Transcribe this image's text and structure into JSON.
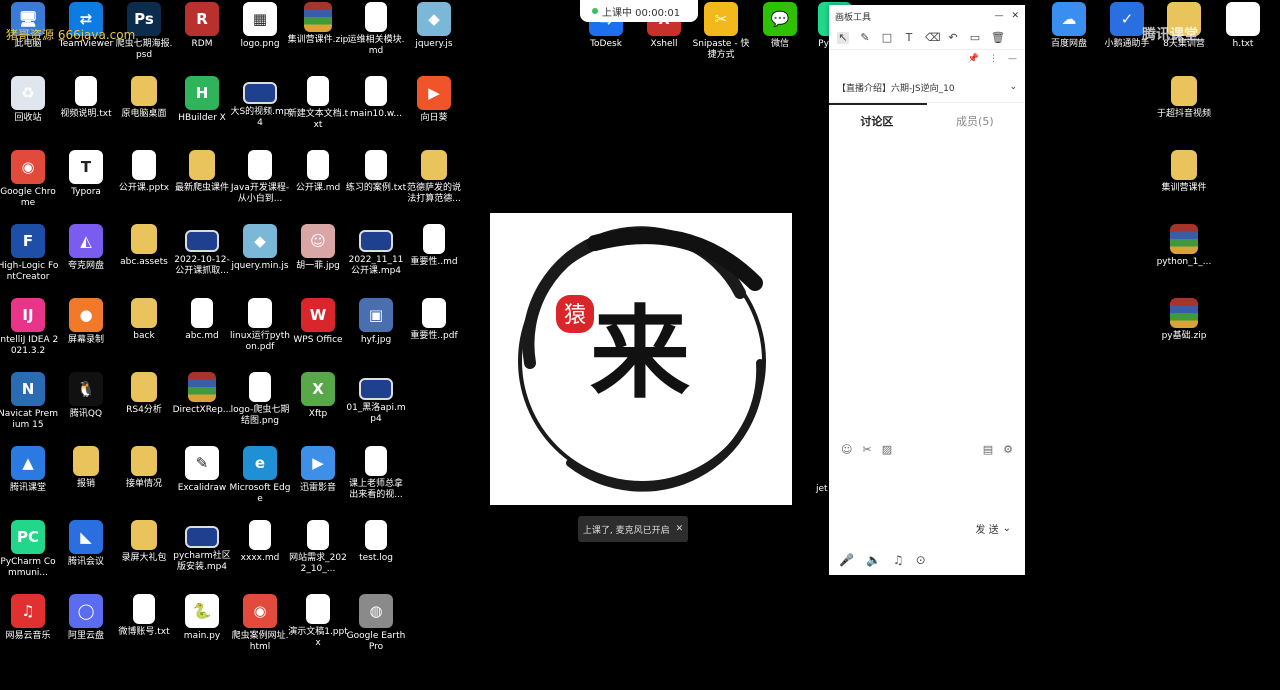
{
  "desktop_icons": [
    {
      "label": "此电脑",
      "icon": "computer-icon",
      "kind": "app",
      "color": "#3a7bd5",
      "glyph": "🖥"
    },
    {
      "label": "TeamViewer",
      "icon": "teamviewer-icon",
      "kind": "app",
      "color": "#0e7be0",
      "glyph": "⇄"
    },
    {
      "label": "爬虫七期海报.psd",
      "icon": "photoshop-icon",
      "kind": "app",
      "color": "#0b2c4c",
      "glyph": "Ps"
    },
    {
      "label": "RDM",
      "icon": "rdm-icon",
      "kind": "app",
      "color": "#b8312f",
      "glyph": "R"
    },
    {
      "label": "logo.png",
      "icon": "image-file-icon",
      "kind": "app",
      "color": "#ffffff",
      "glyph": "▦"
    },
    {
      "label": "集训营课件.zip",
      "icon": "zip-archive-icon",
      "kind": "zip"
    },
    {
      "label": "运维相关模块.md",
      "icon": "markdown-file-icon",
      "kind": "doc"
    },
    {
      "label": "jquery.js",
      "icon": "js-file-icon",
      "kind": "app",
      "color": "#7bb8d8",
      "glyph": "◆"
    },
    {
      "label": "回收站",
      "icon": "recycle-bin-icon",
      "kind": "app",
      "color": "#dfe6ee",
      "glyph": "♻"
    },
    {
      "label": "视频说明.txt",
      "icon": "text-file-icon",
      "kind": "doc"
    },
    {
      "label": "原电脑桌面",
      "icon": "folder-icon",
      "kind": "folder"
    },
    {
      "label": "HBuilder X",
      "icon": "hbuilder-icon",
      "kind": "app",
      "color": "#2eb45a",
      "glyph": "H"
    },
    {
      "label": "大S的视频.mp4",
      "icon": "video-file-icon",
      "kind": "video"
    },
    {
      "label": "新建文本文档.txt",
      "icon": "text-file-icon",
      "kind": "doc"
    },
    {
      "label": "main10.w...",
      "icon": "text-file-icon",
      "kind": "doc"
    },
    {
      "label": "向日葵",
      "icon": "sunflower-icon",
      "kind": "app",
      "color": "#f0552a",
      "glyph": "▶"
    },
    {
      "label": "Google Chrome",
      "icon": "chrome-icon",
      "kind": "app",
      "color": "#e24a3b",
      "glyph": "◉"
    },
    {
      "label": "Typora",
      "icon": "typora-icon",
      "kind": "app",
      "color": "#ffffff",
      "glyph": "T"
    },
    {
      "label": "公开课.pptx",
      "icon": "pptx-file-icon",
      "kind": "ppt"
    },
    {
      "label": "最新爬虫课件",
      "icon": "folder-icon",
      "kind": "folder"
    },
    {
      "label": "Java开发课程-从小白到...",
      "icon": "pdf-file-icon",
      "kind": "pdf"
    },
    {
      "label": "公开课.md",
      "icon": "markdown-file-icon",
      "kind": "doc"
    },
    {
      "label": "练习的案例.txt",
      "icon": "text-file-icon",
      "kind": "doc"
    },
    {
      "label": "范德萨发的说法打算范德...",
      "icon": "folder-icon",
      "kind": "folder"
    },
    {
      "label": "High-Logic FontCreator",
      "icon": "fontcreator-icon",
      "kind": "app",
      "color": "#1d4ea8",
      "glyph": "F"
    },
    {
      "label": "夸克网盘",
      "icon": "quark-icon",
      "kind": "app",
      "color": "#7a5cf0",
      "glyph": "◭"
    },
    {
      "label": "abc.assets",
      "icon": "folder-icon",
      "kind": "folder"
    },
    {
      "label": "2022-10-12-公开课抓取...",
      "icon": "video-file-icon",
      "kind": "video"
    },
    {
      "label": "jquery.min.js",
      "icon": "js-file-icon",
      "kind": "app",
      "color": "#7bb8d8",
      "glyph": "◆"
    },
    {
      "label": "胡一菲.jpg",
      "icon": "photo-file-icon",
      "kind": "app",
      "color": "#d9a5a5",
      "glyph": "☺"
    },
    {
      "label": "2022_11_11公开课.mp4",
      "icon": "video-file-icon",
      "kind": "video"
    },
    {
      "label": "重要性..md",
      "icon": "markdown-file-icon",
      "kind": "doc"
    },
    {
      "label": "IntelliJ IDEA 2021.3.2",
      "icon": "intellij-icon",
      "kind": "app",
      "color": "#e8358a",
      "glyph": "IJ"
    },
    {
      "label": "屏幕录制",
      "icon": "screen-record-icon",
      "kind": "app",
      "color": "#f07a2a",
      "glyph": "●"
    },
    {
      "label": "back",
      "icon": "folder-icon",
      "kind": "folder"
    },
    {
      "label": "abc.md",
      "icon": "markdown-file-icon",
      "kind": "doc"
    },
    {
      "label": "linux运行python.pdf",
      "icon": "pdf-file-icon",
      "kind": "pdf"
    },
    {
      "label": "WPS Office",
      "icon": "wps-icon",
      "kind": "app",
      "color": "#d9262c",
      "glyph": "W"
    },
    {
      "label": "hyf.jpg",
      "icon": "photo-file-icon",
      "kind": "app",
      "color": "#4a6fb0",
      "glyph": "▣"
    },
    {
      "label": "重要性..pdf",
      "icon": "pdf-file-icon",
      "kind": "pdf"
    },
    {
      "label": "Navicat Premium 15",
      "icon": "navicat-icon",
      "kind": "app",
      "color": "#2b6bb4",
      "glyph": "N"
    },
    {
      "label": "腾讯QQ",
      "icon": "qq-icon",
      "kind": "app",
      "color": "#111111",
      "glyph": "🐧"
    },
    {
      "label": "RS4分析",
      "icon": "folder-icon",
      "kind": "folder"
    },
    {
      "label": "DirectXRep...",
      "icon": "zip-archive-icon",
      "kind": "zip"
    },
    {
      "label": "logo-爬虫七期结图.png",
      "icon": "image-file-icon",
      "kind": "doc"
    },
    {
      "label": "Xftp",
      "icon": "xftp-icon",
      "kind": "app",
      "color": "#58a84a",
      "glyph": "X"
    },
    {
      "label": "01_黑洛api.mp4",
      "icon": "video-file-icon",
      "kind": "video"
    },
    {
      "label": "",
      "icon": "",
      "kind": "none"
    },
    {
      "label": "腾讯课堂",
      "icon": "tencent-classroom-icon",
      "kind": "app",
      "color": "#2a7ae2",
      "glyph": "▲"
    },
    {
      "label": "报销",
      "icon": "folder-icon",
      "kind": "folder"
    },
    {
      "label": "接单情况",
      "icon": "folder-icon",
      "kind": "folder"
    },
    {
      "label": "Excalidraw",
      "icon": "excalidraw-icon",
      "kind": "app",
      "color": "#ffffff",
      "glyph": "✎"
    },
    {
      "label": "Microsoft Edge",
      "icon": "edge-icon",
      "kind": "app",
      "color": "#1f8fd6",
      "glyph": "e"
    },
    {
      "label": "迅雷影音",
      "icon": "xunlei-icon",
      "kind": "app",
      "color": "#3d8fe8",
      "glyph": "▶"
    },
    {
      "label": "课上老师总拿出来看的视...",
      "icon": "text-file-icon",
      "kind": "doc"
    },
    {
      "label": "",
      "icon": "",
      "kind": "none"
    },
    {
      "label": "PyCharm Communi...",
      "icon": "pycharm-icon",
      "kind": "app",
      "color": "#21d789",
      "glyph": "PC"
    },
    {
      "label": "腾讯会议",
      "icon": "tencent-meeting-icon",
      "kind": "app",
      "color": "#2a6fe0",
      "glyph": "◣"
    },
    {
      "label": "录屏大礼包",
      "icon": "folder-icon",
      "kind": "folder"
    },
    {
      "label": "pycharm社区版安装.mp4",
      "icon": "video-file-icon",
      "kind": "video"
    },
    {
      "label": "xxxx.md",
      "icon": "markdown-file-icon",
      "kind": "doc"
    },
    {
      "label": "网站需求_2022_10_...",
      "icon": "word-file-icon",
      "kind": "doc"
    },
    {
      "label": "test.log",
      "icon": "log-file-icon",
      "kind": "doc"
    },
    {
      "label": "",
      "icon": "",
      "kind": "none"
    },
    {
      "label": "网易云音乐",
      "icon": "netease-music-icon",
      "kind": "app",
      "color": "#e03030",
      "glyph": "♫"
    },
    {
      "label": "阿里云盘",
      "icon": "aliyun-drive-icon",
      "kind": "app",
      "color": "#5a6cf0",
      "glyph": "◯"
    },
    {
      "label": "微博账号.txt",
      "icon": "text-file-icon",
      "kind": "doc"
    },
    {
      "label": "main.py",
      "icon": "python-file-icon",
      "kind": "app",
      "color": "#ffffff",
      "glyph": "🐍"
    },
    {
      "label": "爬虫案例网址.html",
      "icon": "chrome-html-icon",
      "kind": "app",
      "color": "#e24a3b",
      "glyph": "◉"
    },
    {
      "label": "演示文稿1.pptx",
      "icon": "pptx-file-icon",
      "kind": "ppt"
    },
    {
      "label": "Google Earth Pro",
      "icon": "google-earth-icon",
      "kind": "app",
      "color": "#8a8a8a",
      "glyph": "◍"
    },
    {
      "label": "",
      "icon": "",
      "kind": "none"
    }
  ],
  "top_icons": [
    {
      "label": "ToDesk",
      "icon": "todesk-icon",
      "color": "#1d6ff0",
      "glyph": "⇆"
    },
    {
      "label": "Xshell",
      "icon": "xshell-icon",
      "color": "#c8302b",
      "glyph": "X"
    },
    {
      "label": "Snipaste - 快捷方式",
      "icon": "snipaste-icon",
      "color": "#f2b81c",
      "glyph": "✂"
    },
    {
      "label": "微信",
      "icon": "wechat-icon",
      "color": "#2dc100",
      "glyph": "💬"
    },
    {
      "label": "Py 20...",
      "icon": "pycharm-icon",
      "color": "#21d789",
      "glyph": "P"
    },
    {
      "label": "百度网盘",
      "icon": "baidu-netdisk-icon",
      "color": "#3a8ef0",
      "glyph": "☁"
    },
    {
      "label": "小鹅通助手",
      "icon": "xiaoe-icon",
      "color": "#2a6fe0",
      "glyph": "✓"
    },
    {
      "label": "8天集训营",
      "icon": "folder-icon",
      "color": "#e9c35c",
      "glyph": ""
    },
    {
      "label": "h.txt",
      "icon": "text-file-icon",
      "color": "#ffffff",
      "glyph": ""
    }
  ],
  "right_icons": [
    {
      "label": "于超抖音视频",
      "icon": "folder-icon",
      "kind": "folder"
    },
    {
      "label": "集训营课件",
      "icon": "folder-icon",
      "kind": "folder"
    },
    {
      "label": "python_1_...",
      "icon": "zip-archive-icon",
      "kind": "zip"
    },
    {
      "label": "py基础.zip",
      "icon": "zip-archive-icon",
      "kind": "zip"
    }
  ],
  "live_badge": {
    "text": "上课中 00:00:01",
    "color": "#35c25a"
  },
  "toast": {
    "text": "上课了, 麦克风已开启"
  },
  "panel": {
    "title": "画板工具",
    "course_title": "【直播介绍】六期-JS逆向_10",
    "tab_discussion": "讨论区",
    "tab_members": "成员(5)",
    "send_label": "发 送"
  },
  "watermark": "腾讯课堂",
  "corner_mark": "猪哥资源 666java.com",
  "logo": {
    "seal_char": "猿",
    "main_char": "来",
    "seal_color": "#d8262a"
  },
  "partial_label": "jet"
}
